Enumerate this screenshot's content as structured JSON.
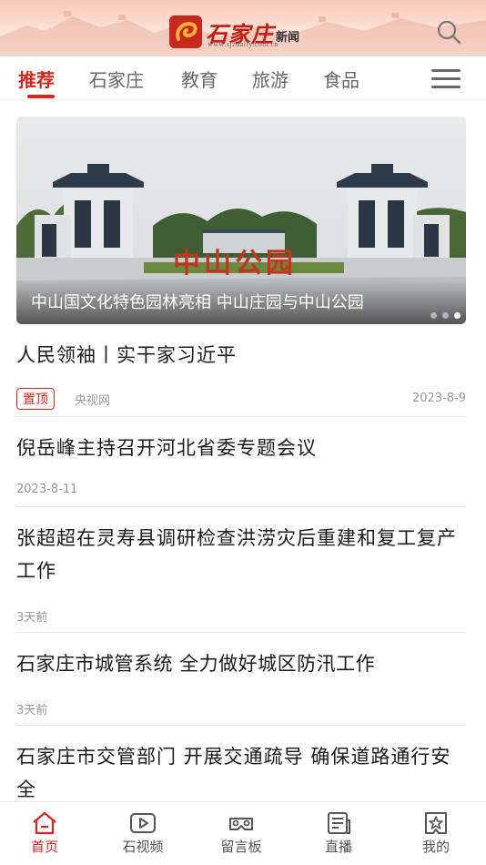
{
  "header": {
    "logo_text": "石家庄",
    "logo_sub": "新闻",
    "logo_url": "www.sjzdaily.com.cn"
  },
  "tabs": [
    {
      "label": "推荐",
      "active": true
    },
    {
      "label": "石家庄",
      "active": false
    },
    {
      "label": "教育",
      "active": false
    },
    {
      "label": "旅游",
      "active": false
    },
    {
      "label": "食品",
      "active": false
    }
  ],
  "banner": {
    "caption": "中山国文化特色园林亮相 中山庄园与中山公园",
    "sign_text": "中山公园",
    "slide_count": 3,
    "active_slide": 3
  },
  "news": [
    {
      "title": "人民领袖丨实干家习近平",
      "badge": "置顶",
      "source": "央视网",
      "date": "2023-8-9"
    },
    {
      "title": "倪岳峰主持召开河北省委专题会议",
      "date": "2023-8-11"
    },
    {
      "title": "张超超在灵寿县调研检查洪涝灾后重建和复工复产工作",
      "date": "3天前"
    },
    {
      "title": "石家庄市城管系统 全力做好城区防汛工作",
      "date": "3天前"
    },
    {
      "title": "石家庄市交管部门 开展交通疏导 确保道路通行安全"
    }
  ],
  "bottom_nav": [
    {
      "label": "首页",
      "icon": "home-icon",
      "active": true
    },
    {
      "label": "石视频",
      "icon": "video-icon",
      "active": false
    },
    {
      "label": "留言板",
      "icon": "vr-glasses-icon",
      "active": false
    },
    {
      "label": "直播",
      "icon": "newspaper-icon",
      "active": false
    },
    {
      "label": "我的",
      "icon": "profile-star-icon",
      "active": false
    }
  ],
  "colors": {
    "accent": "#d2271d",
    "header_tint": "#f6c9b8"
  }
}
